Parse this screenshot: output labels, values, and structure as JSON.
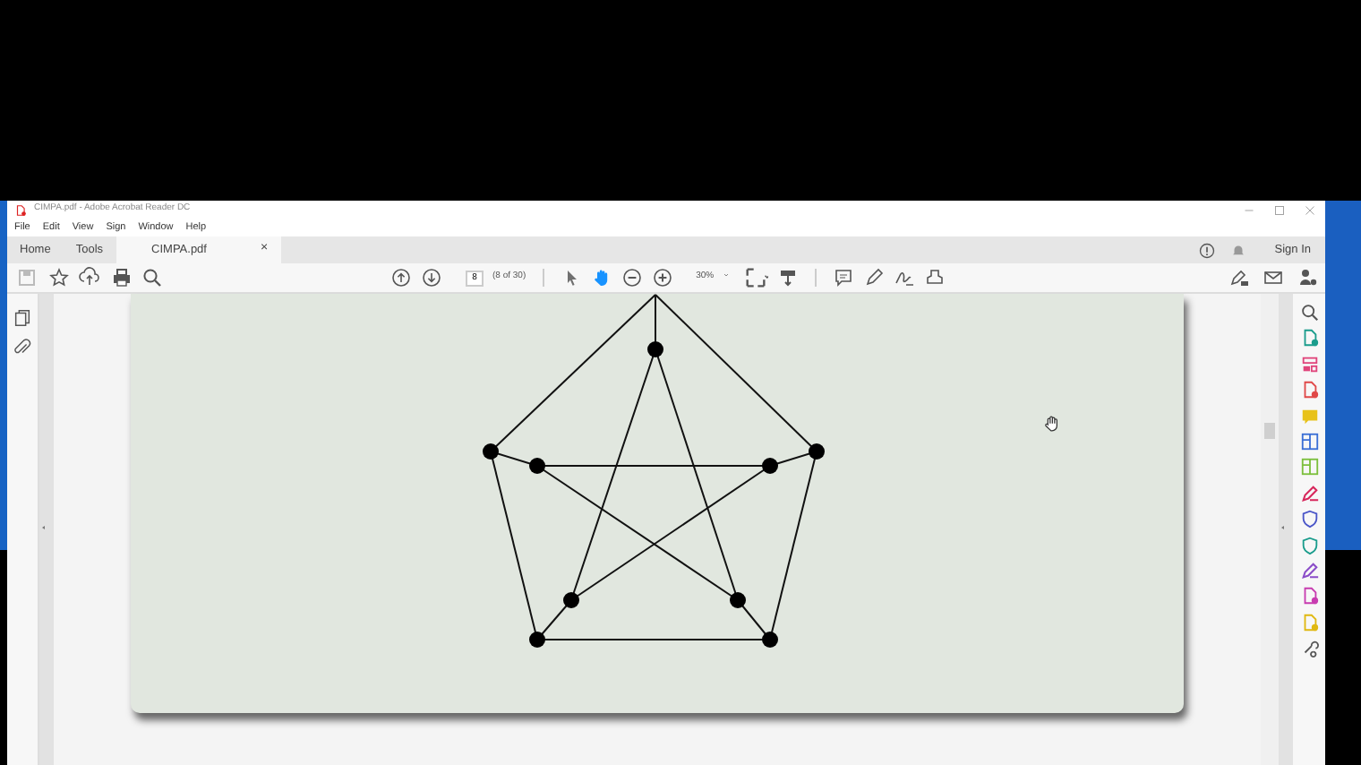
{
  "window": {
    "title": "CIMPA.pdf - Adobe Acrobat Reader DC"
  },
  "menu": [
    "File",
    "Edit",
    "View",
    "Sign",
    "Window",
    "Help"
  ],
  "tabs": [
    {
      "label": "Home",
      "selected": false
    },
    {
      "label": "Tools",
      "selected": false
    },
    {
      "label": "CIMPA.pdf",
      "selected": true,
      "close": "×"
    }
  ],
  "sign_in": "Sign In",
  "toolbar": {
    "page": "8",
    "page_count": "(8 of 30)",
    "zoom": "30%",
    "tools": [
      {
        "kind": "select",
        "selected": false
      },
      {
        "kind": "hand",
        "selected": true
      }
    ]
  }
}
